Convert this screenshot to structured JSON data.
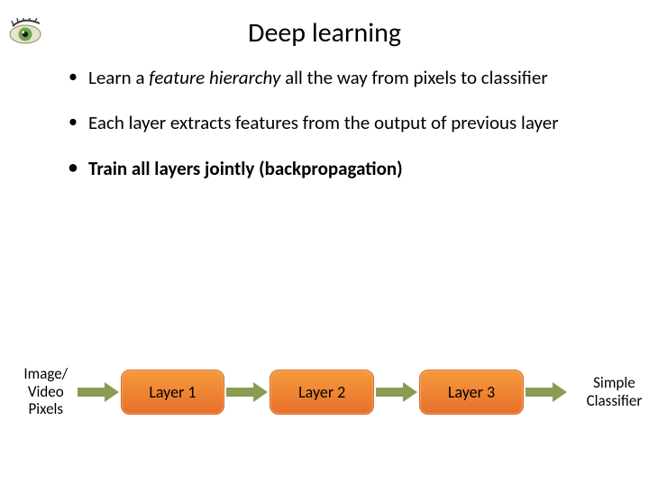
{
  "title": "Deep learning",
  "bullets": {
    "b1_pre": "Learn a ",
    "b1_em": "feature hierarchy",
    "b1_post": " all the way from pixels to classifier",
    "b2": "Each layer extracts features from the output of previous layer",
    "b3": "Train all layers jointly (backpropagation)"
  },
  "flow": {
    "input_l1": "Image/",
    "input_l2": "Video",
    "input_l3": "Pixels",
    "layer1": "Layer 1",
    "layer2": "Layer 2",
    "layer3": "Layer 3",
    "output_l1": "Simple",
    "output_l2": "Classifier"
  },
  "colors": {
    "layer_top": "#f59a3e",
    "layer_bottom": "#e8702a",
    "arrow": "#8a9b53"
  }
}
